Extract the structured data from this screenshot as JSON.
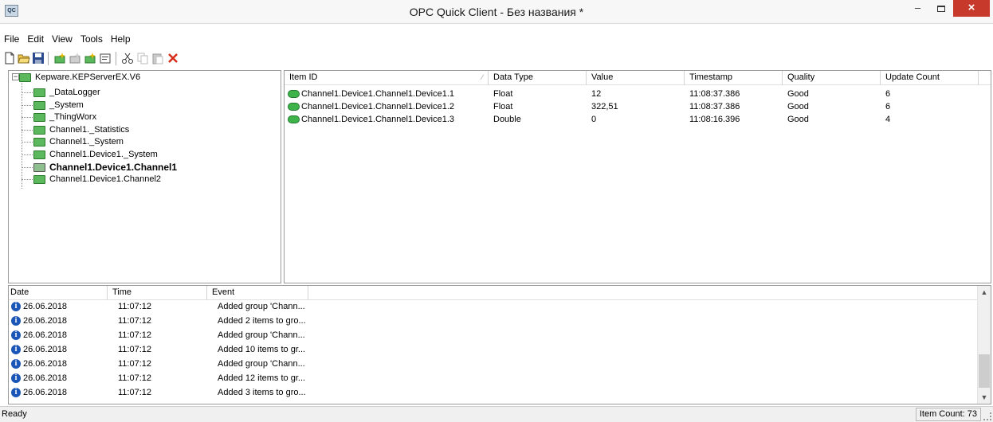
{
  "window": {
    "icon_text": "QC",
    "title": "OPC Quick Client - Без названия *",
    "min_glyph": "–",
    "close_glyph": "×"
  },
  "menu": [
    "File",
    "Edit",
    "View",
    "Tools",
    "Help"
  ],
  "toolbar": [
    "new-icon",
    "open-icon",
    "save-icon",
    "new-server-icon",
    "new-group-icon",
    "new-item-icon",
    "properties-icon",
    "cut-icon",
    "copy-icon",
    "paste-icon",
    "delete-icon"
  ],
  "tree": {
    "root": "Kepware.KEPServerEX.V6",
    "expander": "−",
    "children": [
      "_DataLogger",
      "_System",
      "_ThingWorx",
      "Channel1._Statistics",
      "Channel1._System",
      "Channel1.Device1._System",
      "Channel1.Device1.Channel1",
      "Channel1.Device1.Channel2"
    ]
  },
  "items": {
    "headers": [
      "Item ID",
      "Data Type",
      "Value",
      "Timestamp",
      "Quality",
      "Update Count"
    ],
    "rows": [
      [
        "Channel1.Device1.Channel1.Device1.1",
        "Float",
        "12",
        "11:08:37.386",
        "Good",
        "6"
      ],
      [
        "Channel1.Device1.Channel1.Device1.2",
        "Float",
        "322,51",
        "11:08:37.386",
        "Good",
        "6"
      ],
      [
        "Channel1.Device1.Channel1.Device1.3",
        "Double",
        "0",
        "11:08:16.396",
        "Good",
        "4"
      ]
    ]
  },
  "log": {
    "headers": [
      "Date",
      "Time",
      "Event"
    ],
    "rows": [
      [
        "26.06.2018",
        "11:07:12",
        "Added group 'Chann..."
      ],
      [
        "26.06.2018",
        "11:07:12",
        "Added 2 items to gro..."
      ],
      [
        "26.06.2018",
        "11:07:12",
        "Added group 'Chann..."
      ],
      [
        "26.06.2018",
        "11:07:12",
        "Added 10 items to gr..."
      ],
      [
        "26.06.2018",
        "11:07:12",
        "Added group 'Chann..."
      ],
      [
        "26.06.2018",
        "11:07:12",
        "Added 12 items to gr..."
      ],
      [
        "26.06.2018",
        "11:07:12",
        "Added 3 items to gro..."
      ]
    ]
  },
  "status": {
    "text": "Ready",
    "item_count": "Item Count: 73"
  },
  "colors": {
    "close_button": "#c7392b",
    "folder": "#5cb85c",
    "item_icon": "#3db34a",
    "info_icon": "#1a56b8"
  }
}
